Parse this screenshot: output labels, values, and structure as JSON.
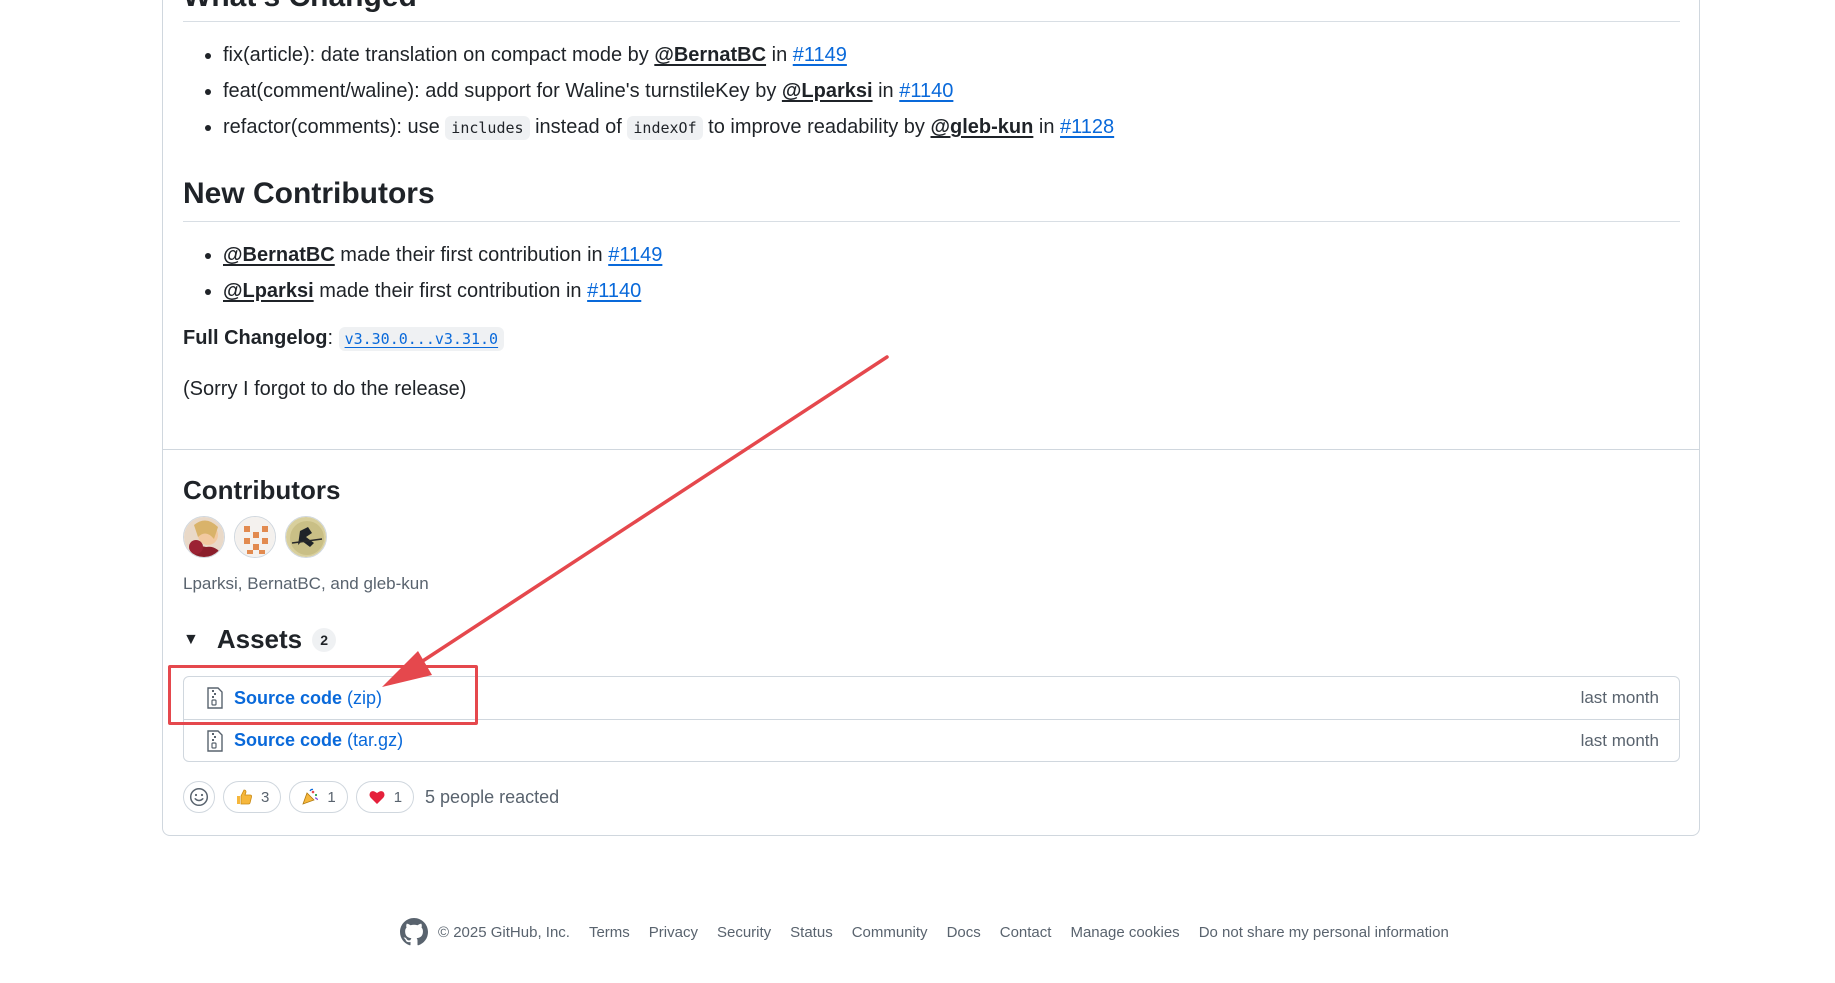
{
  "whats_changed": {
    "heading": "What's Changed",
    "items": [
      {
        "text_before": "fix(article): date translation on compact mode by ",
        "user": "@BernatBC",
        "mid": " in ",
        "pr": "#1149"
      },
      {
        "text_before": "feat(comment/waline): add support for Waline's turnstileKey by ",
        "user": "@Lparksi",
        "mid": " in ",
        "pr": "#1140"
      },
      {
        "text_before": "refactor(comments): use ",
        "code1": "includes",
        "text_mid": " instead of ",
        "code2": "indexOf",
        "text_after": " to improve readability by ",
        "user": "@gleb-kun",
        "mid": " in ",
        "pr": "#1128"
      }
    ]
  },
  "new_contributors": {
    "heading": "New Contributors",
    "items": [
      {
        "user": "@BernatBC",
        "text": " made their first contribution in ",
        "pr": "#1149"
      },
      {
        "user": "@Lparksi",
        "text": " made their first contribution in ",
        "pr": "#1140"
      }
    ]
  },
  "changelog": {
    "label": "Full Changelog",
    "colon": ": ",
    "range": "v3.30.0...v3.31.0"
  },
  "note": "(Sorry I forgot to do the release)",
  "contributors": {
    "heading": "Contributors",
    "names": "Lparksi, BernatBC, and gleb-kun"
  },
  "assets": {
    "title": "Assets",
    "count": "2",
    "rows": [
      {
        "name": "Source code",
        "ext": "(zip)",
        "date": "last month"
      },
      {
        "name": "Source code",
        "ext": "(tar.gz)",
        "date": "last month"
      }
    ]
  },
  "reactions": {
    "thumbs_up": "3",
    "tada": "1",
    "heart": "1",
    "summary": "5 people reacted"
  },
  "footer": {
    "copyright": "© 2025 GitHub, Inc.",
    "links": [
      "Terms",
      "Privacy",
      "Security",
      "Status",
      "Community",
      "Docs",
      "Contact",
      "Manage cookies",
      "Do not share my personal information"
    ]
  },
  "colors": {
    "link": "#0969da",
    "annotation": "#e5484d"
  }
}
